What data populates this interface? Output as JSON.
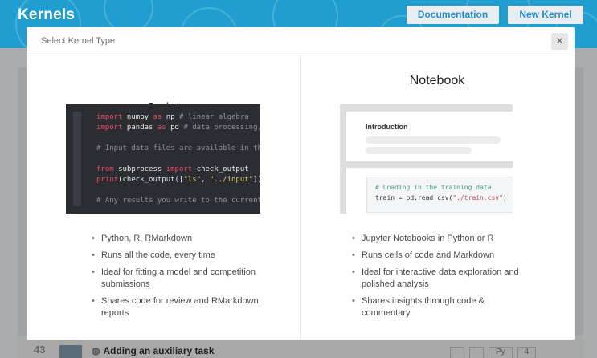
{
  "app": {
    "brand": "Kernels",
    "documentation_label": "Documentation",
    "new_kernel_label": "New Kernel"
  },
  "background_list": {
    "vote_count": "43",
    "kernel_title": "Adding an auxiliary task",
    "tags": [
      "",
      "",
      "Py",
      "4"
    ]
  },
  "modal": {
    "title": "Select Kernel Type",
    "close_symbol": "✕",
    "options": [
      {
        "heading": "Script",
        "features": [
          "Python, R, RMarkdown",
          "Runs all the code, every time",
          "Ideal for fitting a model and competition submissions",
          "Shares code for review and RMarkdown reports"
        ]
      },
      {
        "heading": "Notebook",
        "preview_heading": "Introduction",
        "features": [
          "Jupyter Notebooks in Python or R",
          "Runs cells of code and Markdown",
          "Ideal for interactive data exploration and polished analysis",
          "Shares insights through code & commentary"
        ]
      }
    ]
  },
  "colors": {
    "brand_blue": "#1f9ecf",
    "code_bg": "#2b2d33",
    "keyword": "#e64a61"
  }
}
